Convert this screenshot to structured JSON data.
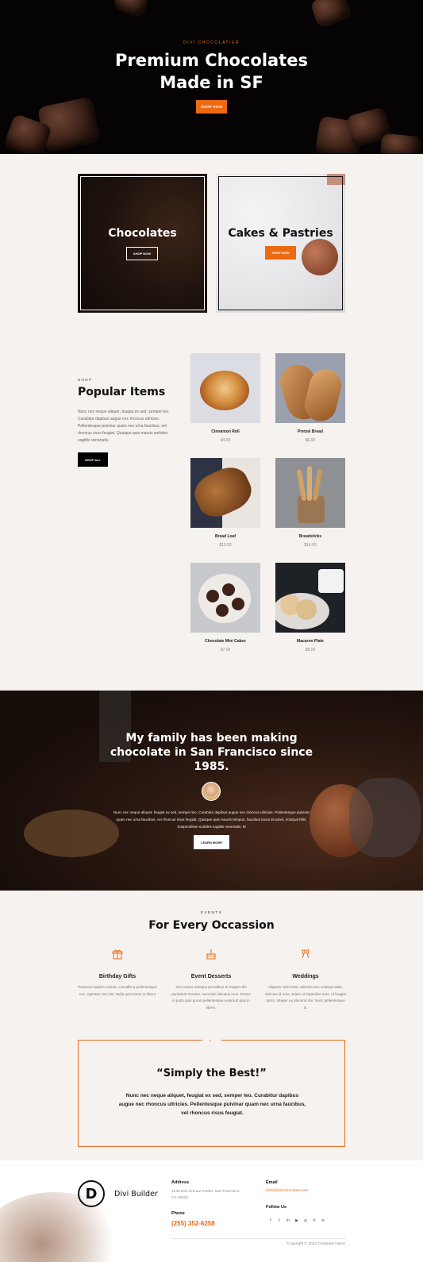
{
  "hero": {
    "eyebrow": "DIVI CHOCOLATIER",
    "title_line1": "Premium Chocolates",
    "title_line2": "Made in SF",
    "button": "SHOP NOW"
  },
  "categories": [
    {
      "title": "Chocolates",
      "button": "SHOP NOW"
    },
    {
      "title": "Cakes & Pastries",
      "button": "SHOP NOW"
    }
  ],
  "popular": {
    "eyebrow": "SHOP",
    "title": "Popular Items",
    "body": "Nunc nec neque aliquet, feugiat ex sed, semper leo. Curabitur dapibus augue nec rhoncus ultricies. Pellentesque pulvinar quam nec urna faucibus, vel rhoncus risus feugiat. Quisque quis mauris sodales sagittis venenatis.",
    "button": "SHOP ALL",
    "products": [
      {
        "name": "Cinnamon Roll",
        "price": "$4.00"
      },
      {
        "name": "Pretzel Bread",
        "price": "$6.00"
      },
      {
        "name": "Bread Loaf",
        "price": "$12.00"
      },
      {
        "name": "Breadsticks",
        "price": "$14.00"
      },
      {
        "name": "Chocolate Mini Cakes",
        "price": "$7.00"
      },
      {
        "name": "Macaron Plate",
        "price": "$8.00"
      }
    ]
  },
  "story": {
    "title_line1": "My family has been making",
    "title_line2": "chocolate in San Francisco since",
    "title_line3": "1985.",
    "body": "Nunc nec neque aliquet, feugiat ex sed, semper leo. Curabitur dapibus augue nec rhoncus ultricies. Pellentesque pulvinar quam nec urna faucibus, vel rhoncus risus feugiat. Quisque quis mauris tempus, faucibus lacus sit amet, volutpat felis. Suspendisse sodales sagittis venenatis. M",
    "button": "LEARN MORE"
  },
  "events": {
    "eyebrow": "EVENTS",
    "title": "For Every Occassion",
    "items": [
      {
        "icon": "gift-icon",
        "title": "Birthday Gifts",
        "desc": "Praesent sapien massa, convallis a pellentesque nec, egestas non nisi. Nulla quis lorem ut libero"
      },
      {
        "icon": "cake-icon",
        "title": "Event Desserts",
        "desc": "Orci varius natoque penatibus et magnis dis parturient montes, nascetur ridiculus mus. Donec in justo quis purus pellentesque euismod quis in libero."
      },
      {
        "icon": "champagne-icon",
        "title": "Weddings",
        "desc": "Aliquam velit tortor, ultricies non volutpat vitae, ultricies id urna. Etiam et imperdiet eros, ut feugiat tortor. Integer eu placerat dui. Nunc pellentesque ni."
      }
    ]
  },
  "testimonial": {
    "quote_title": "“Simply the Best!”",
    "text": "Nunc nec neque aliquet, feugiat ex sed, semper leo. Curabitur dapibus augue nec rhoncus ultricies. Pellentesque pulvinar quam nec urna faucibus, vel rhoncus risus feugiat."
  },
  "footer": {
    "logo_letter": "D",
    "brand": "Divi Builder",
    "address_label": "Address",
    "address_line1": "1235 Divi Avenue #1000, San Francisco,",
    "address_line2": "CA 49623",
    "phone_label": "Phone",
    "phone": "(255) 352-6258",
    "email_label": "Email",
    "email": "hello@divichocolate.com",
    "follow_label": "Follow Us",
    "social_icons": [
      "facebook-icon",
      "twitter-icon",
      "linkedin-icon",
      "youtube-icon",
      "instagram-icon",
      "pinterest-icon",
      "rss-icon"
    ],
    "copyright": "Copyright © 2022 Company Name"
  },
  "colors": {
    "accent": "#ec6a12",
    "dark": "#050304",
    "background": "#f5f2ef"
  }
}
